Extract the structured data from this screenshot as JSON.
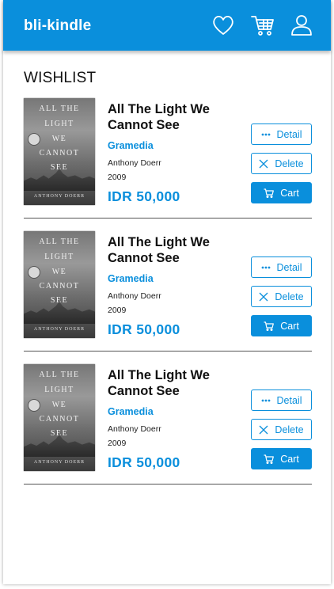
{
  "app": {
    "brand": "bli-kindle",
    "accent_color": "#0a8fdc",
    "nav_icons": [
      "heart-icon",
      "cart-icon",
      "user-icon"
    ]
  },
  "page": {
    "title": "WISHLIST"
  },
  "buttons": {
    "detail": "Detail",
    "delete": "Delete",
    "cart": "Cart"
  },
  "cover": {
    "lines": [
      "ALL THE",
      "LIGHT",
      "WE",
      "CANNOT",
      "SEE"
    ],
    "author": "ANTHONY DOERR"
  },
  "items": [
    {
      "title": "All The Light We Cannot See",
      "publisher": "Gramedia",
      "author": "Anthony Doerr",
      "year": "2009",
      "price": "IDR 50,000"
    },
    {
      "title": "All The Light We Cannot See",
      "publisher": "Gramedia",
      "author": "Anthony Doerr",
      "year": "2009",
      "price": "IDR 50,000"
    },
    {
      "title": "All The Light We Cannot See",
      "publisher": "Gramedia",
      "author": "Anthony Doerr",
      "year": "2009",
      "price": "IDR 50,000"
    }
  ]
}
